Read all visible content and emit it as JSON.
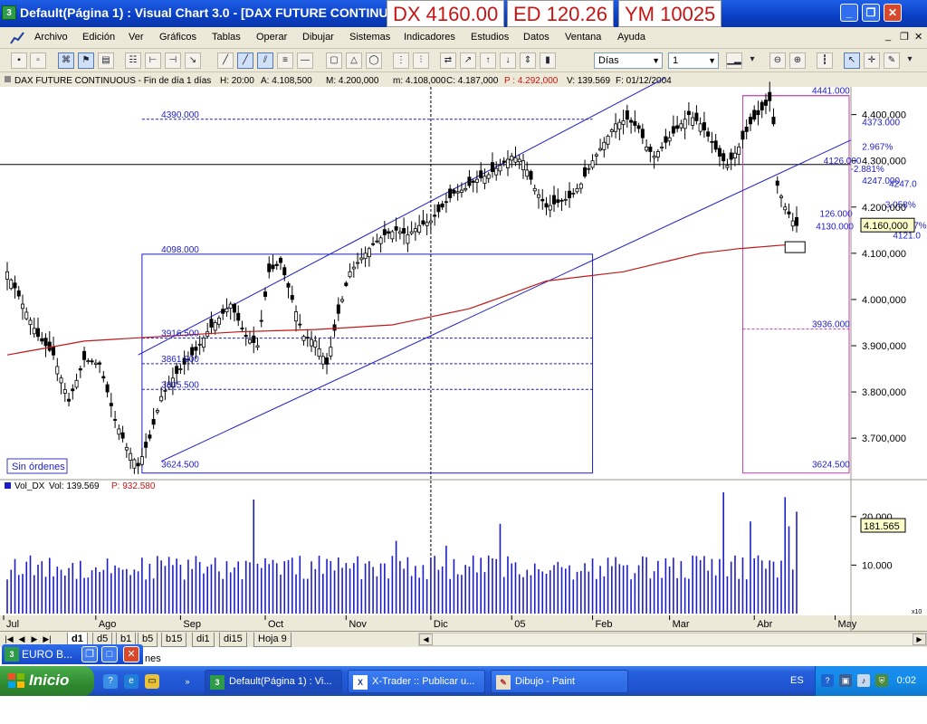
{
  "window": {
    "app_icon": "3",
    "title": "Default(Página 1) : Visual Chart  3.0 - [DAX FUTURE CONTINUOUS",
    "controls": {
      "minimize": "_",
      "restore": "❐",
      "close": "✕"
    }
  },
  "tickers": [
    {
      "label": "DX  4160.00"
    },
    {
      "label": "ED  120.26"
    },
    {
      "label": "YM  10025"
    }
  ],
  "menu": [
    "Archivo",
    "Edición",
    "Ver",
    "Gráficos",
    "Tablas",
    "Operar",
    "Dibujar",
    "Sistemas",
    "Indicadores",
    "Estudios",
    "Datos",
    "Ventana",
    "Ayuda"
  ],
  "mdi_controls": {
    "minimize": "_",
    "restore": "❐",
    "close": "✕"
  },
  "toolbar": {
    "period_select": "Días",
    "interval_select": "1"
  },
  "status": {
    "orders_label": "Sin órdenes"
  },
  "chart_data": [
    {
      "type": "candlestick",
      "header": {
        "instrument": "DAX FUTURE CONTINUOUS - Fin de día 1 días",
        "hora": "H: 20:00",
        "apertura": "A: 4.108,500",
        "maximo": "M: 4.200,000",
        "minimo": "m: 4.108,000",
        "cierre": "C: 4.187,000",
        "p": "P : 4.292,000",
        "volumen": "V: 139.569",
        "fecha": "F: 01/12/2004"
      },
      "color_up": "#000000",
      "color_down": "#000000",
      "ylim": [
        3620,
        4460
      ],
      "yticks": [
        "4.400,000",
        "4.300,000",
        "4.200,000",
        "4.100,000",
        "4.000,000",
        "3.900,000",
        "3.800,000",
        "3.700,000"
      ],
      "ytick_values": [
        4400,
        4300,
        4200,
        4100,
        4000,
        3900,
        3800,
        3700
      ],
      "xticks": [
        "Jul",
        "Ago",
        "Sep",
        "Oct",
        "Nov",
        "Dic",
        "05",
        "Feb",
        "Mar",
        "Abr",
        "May"
      ],
      "xtick_sessions": [
        -4,
        23,
        45,
        67,
        88,
        110,
        131,
        152,
        172,
        194,
        215
      ],
      "sessions": 205,
      "waypoints": [
        [
          0,
          4060
        ],
        [
          4,
          3990
        ],
        [
          8,
          3920
        ],
        [
          12,
          3880
        ],
        [
          16,
          3780
        ],
        [
          20,
          3870
        ],
        [
          24,
          3860
        ],
        [
          28,
          3740
        ],
        [
          31,
          3680
        ],
        [
          34,
          3640
        ],
        [
          37,
          3700
        ],
        [
          40,
          3790
        ],
        [
          43,
          3830
        ],
        [
          46,
          3860
        ],
        [
          49,
          3890
        ],
        [
          52,
          3930
        ],
        [
          55,
          3960
        ],
        [
          58,
          3990
        ],
        [
          62,
          3920
        ],
        [
          65,
          3900
        ],
        [
          68,
          4060
        ],
        [
          71,
          4080
        ],
        [
          74,
          4000
        ],
        [
          77,
          3920
        ],
        [
          80,
          3910
        ],
        [
          83,
          3860
        ],
        [
          86,
          3970
        ],
        [
          89,
          4060
        ],
        [
          92,
          4090
        ],
        [
          95,
          4120
        ],
        [
          98,
          4140
        ],
        [
          101,
          4150
        ],
        [
          104,
          4140
        ],
        [
          107,
          4160
        ],
        [
          110,
          4170
        ],
        [
          113,
          4200
        ],
        [
          116,
          4230
        ],
        [
          119,
          4240
        ],
        [
          122,
          4260
        ],
        [
          125,
          4270
        ],
        [
          128,
          4290
        ],
        [
          131,
          4310
        ],
        [
          134,
          4300
        ],
        [
          137,
          4240
        ],
        [
          140,
          4200
        ],
        [
          143,
          4210
        ],
        [
          146,
          4220
        ],
        [
          149,
          4250
        ],
        [
          152,
          4300
        ],
        [
          155,
          4340
        ],
        [
          158,
          4380
        ],
        [
          161,
          4390
        ],
        [
          164,
          4370
        ],
        [
          166,
          4330
        ],
        [
          168,
          4310
        ],
        [
          171,
          4340
        ],
        [
          174,
          4370
        ],
        [
          177,
          4400
        ],
        [
          180,
          4380
        ],
        [
          183,
          4340
        ],
        [
          185,
          4310
        ],
        [
          187,
          4290
        ],
        [
          190,
          4330
        ],
        [
          193,
          4380
        ],
        [
          196,
          4410
        ],
        [
          198,
          4430
        ],
        [
          199,
          4380
        ],
        [
          200,
          4247
        ],
        [
          202,
          4200
        ],
        [
          204,
          4170
        ],
        [
          205,
          4160
        ]
      ],
      "moving_average": [
        [
          0,
          3880
        ],
        [
          20,
          3910
        ],
        [
          40,
          3920
        ],
        [
          60,
          3930
        ],
        [
          80,
          3935
        ],
        [
          100,
          3945
        ],
        [
          120,
          3980
        ],
        [
          140,
          4040
        ],
        [
          160,
          4060
        ],
        [
          170,
          4080
        ],
        [
          180,
          4100
        ],
        [
          190,
          4110
        ],
        [
          205,
          4120
        ]
      ],
      "last_value_label": "4.160,000",
      "annotations": [
        {
          "text": "4390.000",
          "value": 4390
        },
        {
          "text": "4098.000",
          "value": 4098
        },
        {
          "text": "3916.500",
          "value": 3916.5
        },
        {
          "text": "3861.000",
          "value": 3861
        },
        {
          "text": "3805.500",
          "value": 3805.5
        },
        {
          "text": "3624.500",
          "value": 3624.5
        },
        {
          "text": "4441.000",
          "value": 4441
        },
        {
          "text": "3936.000",
          "value": 3936
        },
        {
          "text": "3624.500",
          "value": 3624.5
        },
        {
          "text": "4373.000",
          "value": 4373
        },
        {
          "text": "2.967%",
          "value": 4320
        },
        {
          "text": "4126.000",
          "value": 4290
        },
        {
          "text": "-2.881%",
          "value": 4272
        },
        {
          "text": "4247.000",
          "value": 4247
        },
        {
          "text": "4247.0",
          "value": 4240
        },
        {
          "text": "3.058%",
          "value": 4195
        },
        {
          "text": "126.000",
          "value": 4175
        },
        {
          "text": "4130.000",
          "value": 4148
        },
        {
          "text": "-2.967%",
          "value": 4150
        },
        {
          "text": "4121.0",
          "value": 4128
        }
      ]
    },
    {
      "type": "bar",
      "header_name": "Vol_DX",
      "header_vol": "Vol: 139.569",
      "header_p": "P: 932.580",
      "color": "#1c1cc8",
      "ylim": [
        0,
        25
      ],
      "yticks": [
        "20.000",
        "10.000"
      ],
      "ytick_values": [
        20,
        10
      ],
      "sessions": 205,
      "last_value_label": "181.565",
      "spikes": [
        [
          64,
          23.5
        ],
        [
          101,
          15
        ],
        [
          114,
          14
        ],
        [
          128,
          18.5
        ],
        [
          186,
          25
        ],
        [
          193,
          19
        ],
        [
          202,
          24
        ],
        [
          203,
          18
        ],
        [
          205,
          21
        ]
      ]
    }
  ],
  "sheet_tabs": [
    "d1",
    "d5",
    "b1",
    "b5",
    "b15",
    "di1",
    "di15",
    "Hoja 9"
  ],
  "scroll_corner_label": "x10",
  "minimized_window": {
    "icon": "3",
    "title": "EURO B...",
    "strip_label": "nes"
  },
  "taskbar": {
    "start_label": "Inicio",
    "tasks": [
      {
        "icon": "3",
        "label": "Default(Página 1) : Vi..."
      },
      {
        "icon": "X",
        "label": "X-Trader :: Publicar u..."
      },
      {
        "icon": "✎",
        "label": "Dibujo - Paint"
      }
    ],
    "language": "ES",
    "clock": "0:02"
  }
}
